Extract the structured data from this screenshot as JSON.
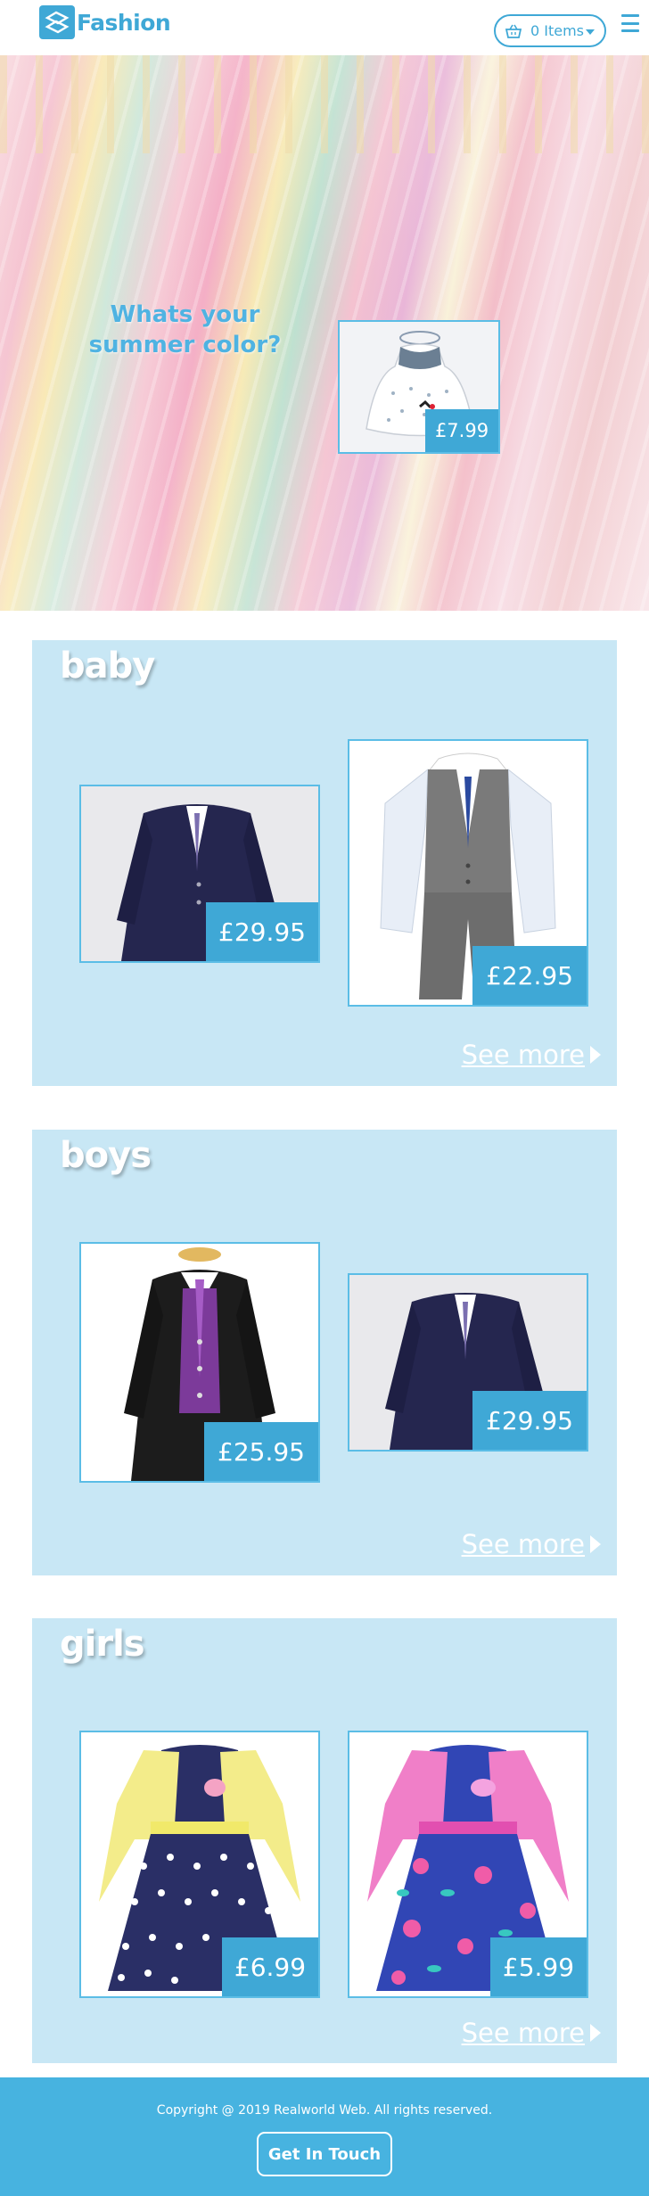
{
  "header": {
    "brand": "Fashion",
    "cart_label": "0 Items",
    "cart_icon": "basket-icon",
    "menu_icon": "hamburger-menu-icon"
  },
  "hero": {
    "title": "Whats your summer color?",
    "featured_price": "£7.99"
  },
  "categories": [
    {
      "name": "baby",
      "products": [
        {
          "price": "£29.95",
          "item": "navy suit"
        },
        {
          "price": "£22.95",
          "item": "grey waistcoat suit"
        }
      ],
      "see_more": "See more"
    },
    {
      "name": "boys",
      "products": [
        {
          "price": "£25.95",
          "item": "black suit with purple waistcoat"
        },
        {
          "price": "£29.95",
          "item": "navy suit"
        }
      ],
      "see_more": "See more"
    },
    {
      "name": "girls",
      "products": [
        {
          "price": "£6.99",
          "item": "navy polka dot dress"
        },
        {
          "price": "£5.99",
          "item": "pink floral dress"
        }
      ],
      "see_more": "See more"
    }
  ],
  "footer": {
    "copyright": "Copyright @ 2019 Realworld Web. All rights reserved.",
    "contact_label": "Get In Touch"
  },
  "colors": {
    "accent": "#3fa8d6",
    "panel": "#c8e7f5",
    "footer": "#47b3e0"
  }
}
